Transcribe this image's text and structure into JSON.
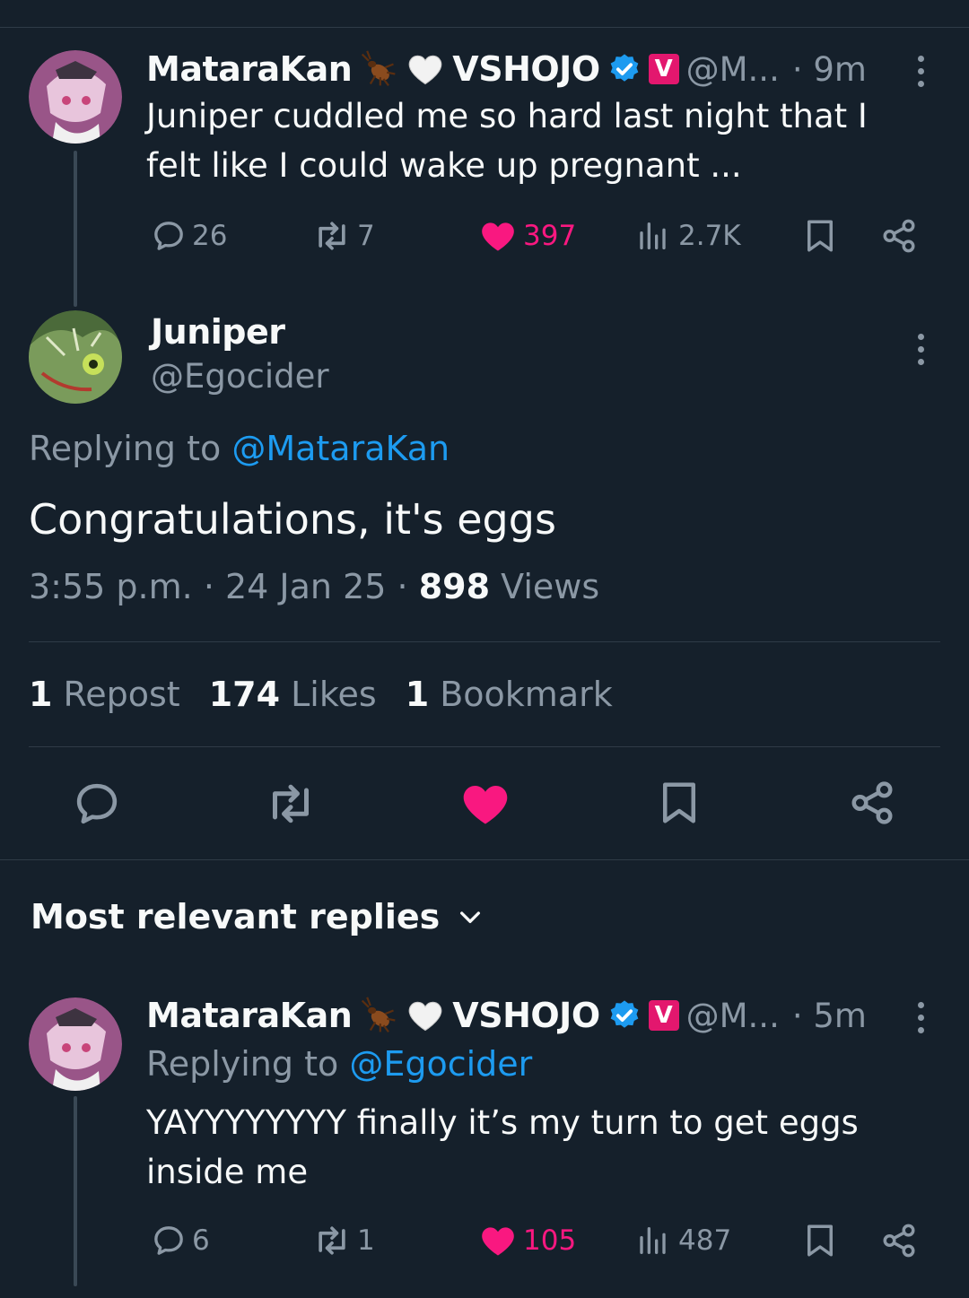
{
  "post1": {
    "name": "MataraKan",
    "org": "VSHOJO",
    "handle": "@M...",
    "time": "· 9m",
    "text": "Juniper cuddled me so hard last night that I felt like I could wake up pregnant ...",
    "replies": "26",
    "reposts": "7",
    "likes": "397",
    "views": "2.7K"
  },
  "main": {
    "name": "Juniper",
    "handle": "@Egocider",
    "replying_prefix": "Replying to",
    "replying_handle": "@MataraKan",
    "text": "Congratulations, it's eggs",
    "time": "3:55 p.m.",
    "date": "24 Jan 25",
    "views_count": "898",
    "views_label": "Views",
    "sep": "·",
    "reposts_count": "1",
    "reposts_label": "Repost",
    "likes_count": "174",
    "likes_label": "Likes",
    "bookmarks_count": "1",
    "bookmarks_label": "Bookmark"
  },
  "replies_header": "Most relevant replies",
  "post2": {
    "name": "MataraKan",
    "org": "VSHOJO",
    "handle": "@M...",
    "time": "· 5m",
    "replying_prefix": "Replying to",
    "replying_handle": "@Egocider",
    "text": "YAYYYYYYYY finally it’s my turn to get eggs inside me",
    "replies": "6",
    "reposts": "1",
    "likes": "105",
    "views": "487"
  },
  "colors": {
    "background": "#15202b",
    "like": "#f91880",
    "link": "#1d9bf0",
    "muted": "#8b98a5",
    "verified": "#1d9bf0",
    "vshojo_badge": "#e3176e"
  },
  "icons": [
    "reply-icon",
    "repost-icon",
    "heart-icon",
    "views-icon",
    "bookmark-icon",
    "share-icon",
    "more-icon",
    "verified-icon",
    "bug-emoji-icon",
    "white-heart-icon",
    "vshojo-badge-icon",
    "chevron-down-icon"
  ]
}
